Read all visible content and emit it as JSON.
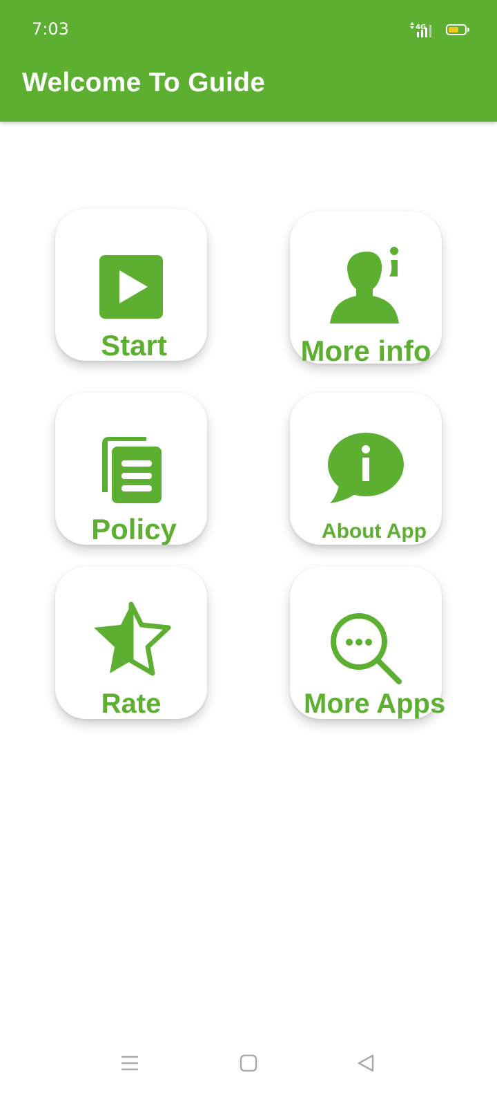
{
  "status_bar": {
    "time": "7:03",
    "network": "4G",
    "battery_color": "#f4c51b",
    "battery_level": 0.65
  },
  "header": {
    "title": "Welcome To Guide",
    "background_color": "#5daf32"
  },
  "accent_color": "#5daf32",
  "menu": {
    "start": {
      "label": "Start",
      "icon": "play-icon"
    },
    "more_info": {
      "label": "More info",
      "icon": "person-info-icon"
    },
    "policy": {
      "label": "Policy",
      "icon": "documents-icon"
    },
    "about_app": {
      "label": "About App",
      "icon": "info-bubble-icon"
    },
    "rate": {
      "label": "Rate",
      "icon": "half-star-icon"
    },
    "more_apps": {
      "label": "More Apps",
      "icon": "search-more-icon"
    }
  },
  "nav_bar": {
    "items": [
      "menu-icon",
      "home-icon",
      "back-icon"
    ]
  }
}
